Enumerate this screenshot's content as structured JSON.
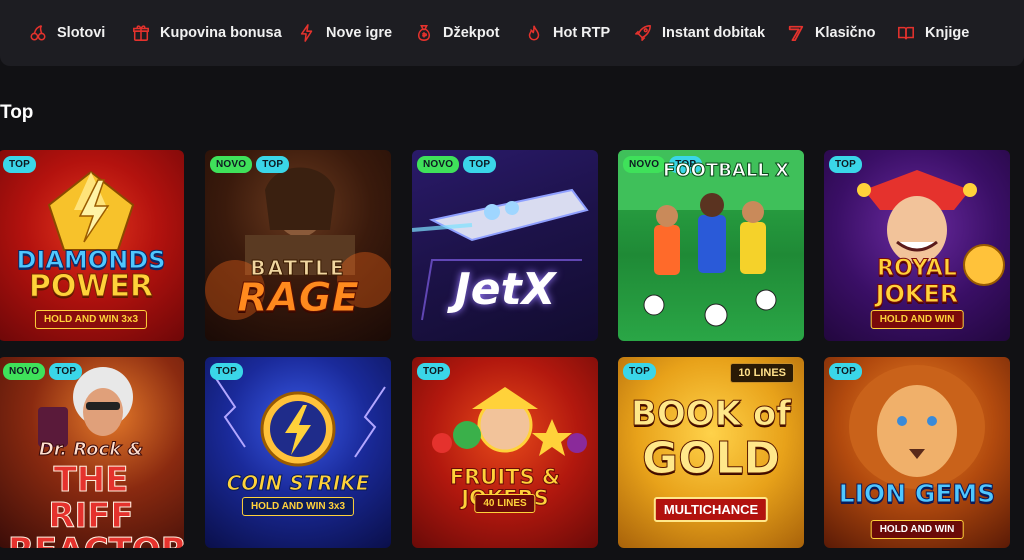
{
  "nav": {
    "items": [
      {
        "label": "Slotovi",
        "icon": "cherries-icon"
      },
      {
        "label": "Kupovina bonusa",
        "icon": "gift-icon"
      },
      {
        "label": "Nove igre",
        "icon": "lightning-icon"
      },
      {
        "label": "Džekpot",
        "icon": "money-bag-icon"
      },
      {
        "label": "Hot RTP",
        "icon": "flame-icon"
      },
      {
        "label": "Instant dobitak",
        "icon": "rocket-icon"
      },
      {
        "label": "Klasično",
        "icon": "seven-icon"
      },
      {
        "label": "Knjige",
        "icon": "book-icon"
      }
    ],
    "accent": "#e5322d"
  },
  "section": {
    "title": "Top"
  },
  "games": [
    {
      "title_l1": "DIAMONDS",
      "title_l2": "POWER",
      "subtitle": "HOLD AND WIN 3x3",
      "badges": [
        "TOP"
      ]
    },
    {
      "title_l1": "BATTLE",
      "title_l2": "RAGE",
      "subtitle": "",
      "badges": [
        "NOVO",
        "TOP"
      ]
    },
    {
      "title_l1": "JetX",
      "title_l2": "",
      "subtitle": "",
      "badges": [
        "NOVO",
        "TOP"
      ]
    },
    {
      "title_l1": "FOOTBALL X",
      "title_l2": "",
      "subtitle": "",
      "badges": [
        "NOVO",
        "TOP"
      ]
    },
    {
      "title_l1": "ROYAL",
      "title_l2": "JOKER",
      "subtitle": "HOLD AND WIN",
      "badges": [
        "TOP"
      ]
    },
    {
      "title_l1": "Dr. Rock &",
      "title_l2": "THE RIFF REACTOR",
      "subtitle": "",
      "badges": [
        "NOVO",
        "TOP"
      ]
    },
    {
      "title_l1": "COIN STRIKE",
      "title_l2": "",
      "subtitle": "HOLD AND WIN 3x3",
      "badges": [
        "TOP"
      ]
    },
    {
      "title_l1": "FRUITS & JOKERS",
      "title_l2": "",
      "subtitle": "40 LINES",
      "badges": [
        "TOP"
      ]
    },
    {
      "title_l1": "BOOK of",
      "title_l2": "GOLD",
      "subtitle": "MULTICHANCE",
      "extra": "10 LINES",
      "badges": [
        "TOP"
      ]
    },
    {
      "title_l1": "LION GEMS",
      "title_l2": "",
      "subtitle": "HOLD AND WIN",
      "badges": [
        "TOP"
      ]
    }
  ]
}
